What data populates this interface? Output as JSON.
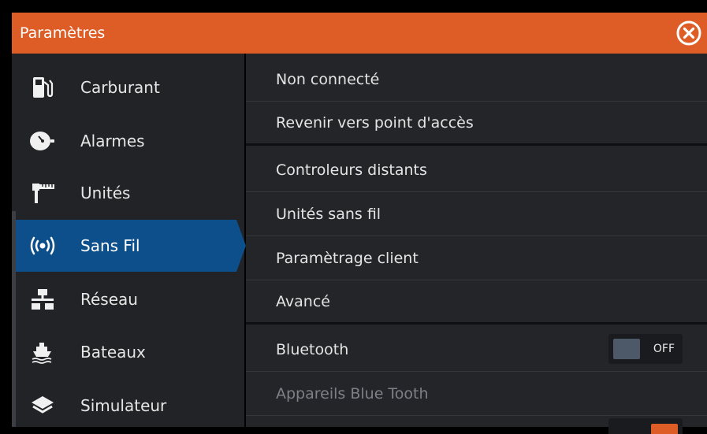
{
  "window": {
    "title": "Paramètres"
  },
  "sidebar": {
    "items": [
      {
        "label": "Carburant",
        "icon": "fuel-pump-icon"
      },
      {
        "label": "Alarmes",
        "icon": "alarm-bell-icon"
      },
      {
        "label": "Unités",
        "icon": "ruler-icon"
      },
      {
        "label": "Sans Fil",
        "icon": "wireless-icon",
        "active": true
      },
      {
        "label": "Réseau",
        "icon": "network-icon"
      },
      {
        "label": "Bateaux",
        "icon": "boat-icon"
      },
      {
        "label": "Simulateur",
        "icon": "layers-icon"
      }
    ]
  },
  "content": {
    "rows": [
      {
        "label": "Non connecté"
      },
      {
        "label": "Revenir vers point d'accès"
      },
      {
        "label": "Controleurs distants"
      },
      {
        "label": "Unités sans fil"
      },
      {
        "label": "Paramètrage client"
      },
      {
        "label": "Avancé"
      },
      {
        "label": "Bluetooth",
        "toggle": "OFF"
      },
      {
        "label": "Appareils Blue Tooth",
        "disabled": true
      }
    ]
  },
  "colors": {
    "accent": "#de5c26",
    "selection": "#0c4f8a",
    "panel": "#232529",
    "sidebar": "#222326"
  }
}
